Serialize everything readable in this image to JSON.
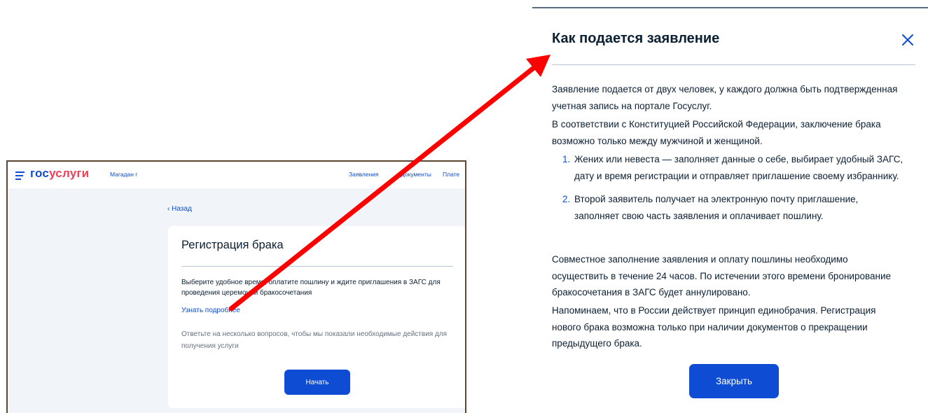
{
  "portal": {
    "logo_part1": "гос",
    "logo_part2": "услуги",
    "city": "Магадан г",
    "nav": [
      "Заявления",
      "Документы",
      "Плате"
    ],
    "back_label": "Назад"
  },
  "service_card": {
    "title": "Регистрация брака",
    "description": "Выберите удобное время, оплатите пошлину и ждите приглашения в ЗАГС для проведения церемонии бракосочетания",
    "more_link": "Узнать подробнее",
    "hint": "Ответьте на несколько вопросов, чтобы мы показали необходимые действия для получения услуги",
    "start_button": "Начать"
  },
  "modal": {
    "title": "Как подается заявление",
    "paragraphs": [
      "Заявление подается от двух человек, у каждого должна быть подтвержденная учетная запись на портале Госуслуг.",
      "В соответствии с Конституцией Российской Федерации, заключение брака возможно только между мужчиной и женщиной."
    ],
    "steps": [
      {
        "num": "1.",
        "text": "Жених или невеста — заполняет данные о себе, выбирает удобный ЗАГС, дату и время регистрации и отправляет приглашение своему избраннику."
      },
      {
        "num": "2.",
        "text": "Второй заявитель получает на электронную почту приглашение, заполняет свою часть заявления и оплачивает пошлину."
      }
    ],
    "paragraphs_after": [
      "Совместное заполнение заявления и оплату пошлины необходимо осуществить в течение 24 часов. По истечении этого времени бронирование бракосочетания в ЗАГС будет аннулировано.",
      "Напоминаем, что в России действует принцип единобрачия. Регистрация нового брака возможна только при наличии документов о прекращении предыдущего брака."
    ],
    "close_button": "Закрыть"
  },
  "colors": {
    "accent": "#0d4cd3",
    "logo_red": "#ee3f58",
    "arrow": "#ff0000",
    "frame_border": "#5b4632"
  },
  "icons": {
    "menu": "hamburger-menu-icon",
    "back": "chevron-left-icon",
    "close": "close-icon",
    "arrow": "red-annotation-arrow"
  }
}
